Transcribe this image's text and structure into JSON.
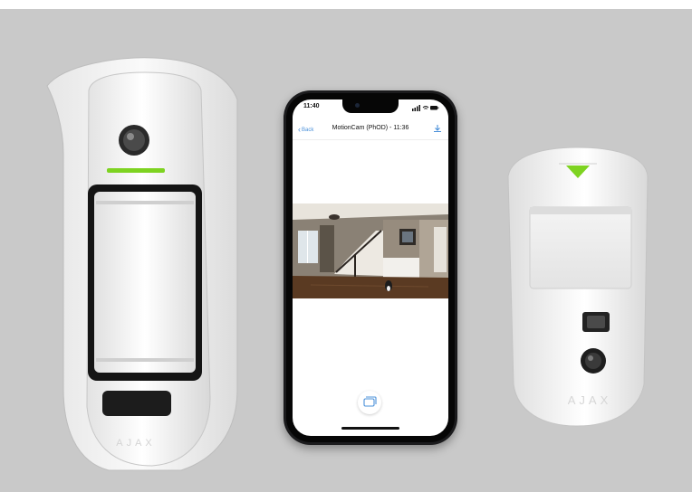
{
  "photo": {
    "left_device": {
      "brand": "AJAX"
    },
    "right_device": {
      "brand": "AJAX"
    },
    "phone": {
      "status_time": "11:40",
      "nav": {
        "back_label": "Back",
        "title": "MotionCam (PhOD) - 11:36",
        "download_icon": "download-icon"
      },
      "snapshot_alt_icon": "gallery-icon"
    }
  }
}
